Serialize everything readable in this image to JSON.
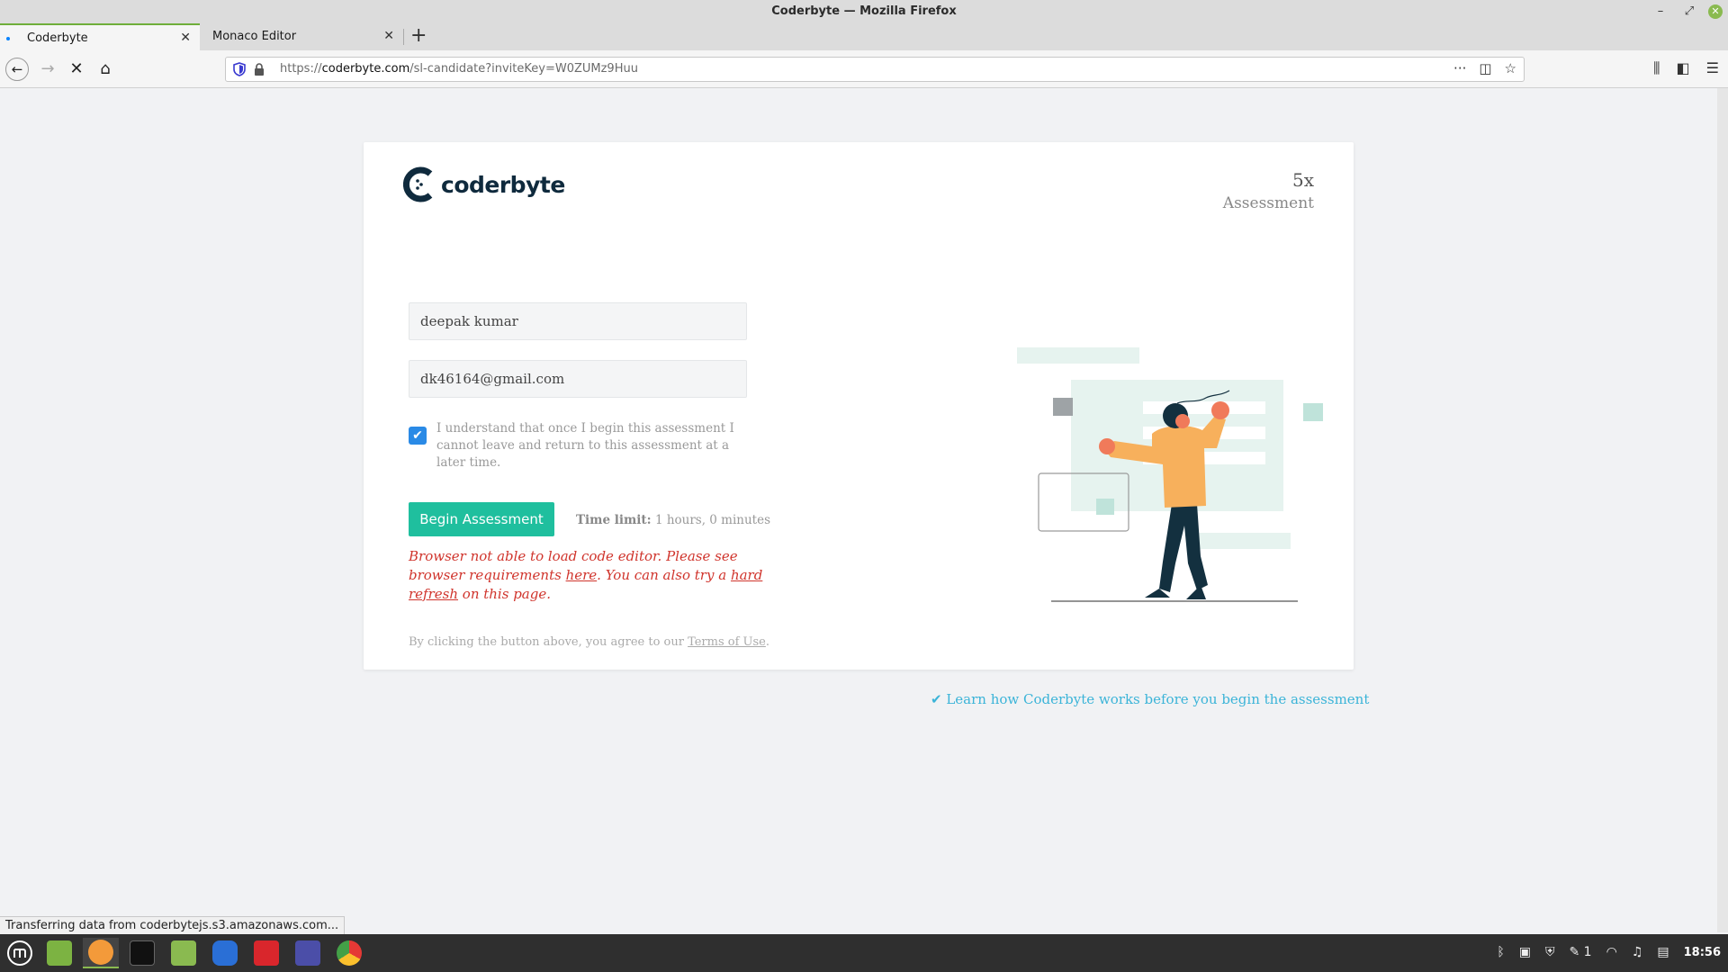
{
  "window": {
    "title": "Coderbyte — Mozilla Firefox"
  },
  "tabs": [
    {
      "label": "Coderbyte",
      "active": true
    },
    {
      "label": "Monaco Editor",
      "active": false
    }
  ],
  "urlbar": {
    "prefix": "https://",
    "host": "coderbyte.com",
    "path": "/sl-candidate?inviteKey=W0ZUMz9Huu"
  },
  "card": {
    "logo_text": "coderbyte",
    "multiplier": "5x",
    "assessment_label": "Assessment",
    "name_value": "deepak kumar",
    "email_value": "dk46164@gmail.com",
    "checkbox_text": "I understand that once I begin this assessment I cannot leave and return to this assessment at a later time.",
    "begin_button": "Begin Assessment",
    "time_limit_label": "Time limit:",
    "time_limit_value": "1 hours, 0 minutes",
    "error": {
      "part1": "Browser not able to load code editor. Please see browser requirements ",
      "link1": "here",
      "part2": ". You can also try a ",
      "link2": "hard refresh",
      "part3": " on this page."
    },
    "terms": {
      "text": "By clicking the button above, you agree to our ",
      "link": "Terms of Use",
      "end": "."
    }
  },
  "learn_link": "✔ Learn how Coderbyte works before you begin the assessment",
  "status_text": "Transferring data from coderbytejs.s3.amazonaws.com...",
  "taskbar": {
    "clock": "18:56",
    "workspace": "1"
  },
  "colors": {
    "accent_green": "#1fbf9e",
    "error_red": "#d0342c",
    "link_blue": "#3bb4d8",
    "checkbox_blue": "#2a8ae6"
  }
}
